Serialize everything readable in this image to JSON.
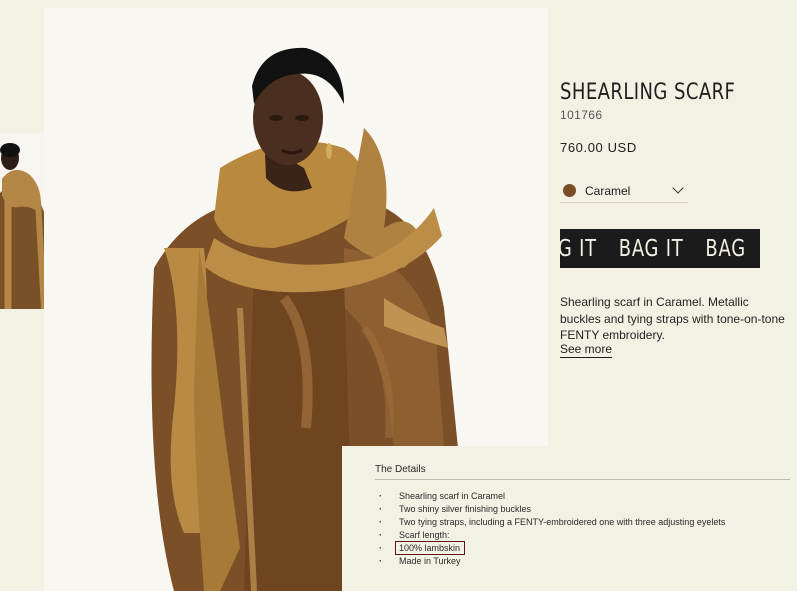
{
  "product": {
    "title": "SHEARLING SCARF",
    "sku": "101766",
    "price": "760.00 USD",
    "color": {
      "label": "Caramel",
      "swatch": "#7b4d26"
    },
    "bag_button": {
      "marquee": [
        "AG IT",
        "BAG IT",
        "BAG"
      ]
    },
    "description": "Shearling scarf in Caramel. Metallic buckles and tying straps with tone-on-tone FENTY embroidery.",
    "see_more": "See more"
  },
  "details": {
    "title": "The Details",
    "items": [
      "Shearling scarf in Caramel",
      "Two shiny silver finishing buckles",
      "Two tying straps, including a FENTY-embroidered one with three adjusting eyelets",
      "Scarf length:",
      "100% lambskin",
      "Made in Turkey"
    ],
    "highlighted_item": "100% lambskin"
  },
  "colors": {
    "background": "#f3f1e4",
    "button": "#1b1b1b",
    "highlight_border": "#5a1417"
  },
  "icons": {
    "color_select_caret": "chevron-down-icon"
  }
}
